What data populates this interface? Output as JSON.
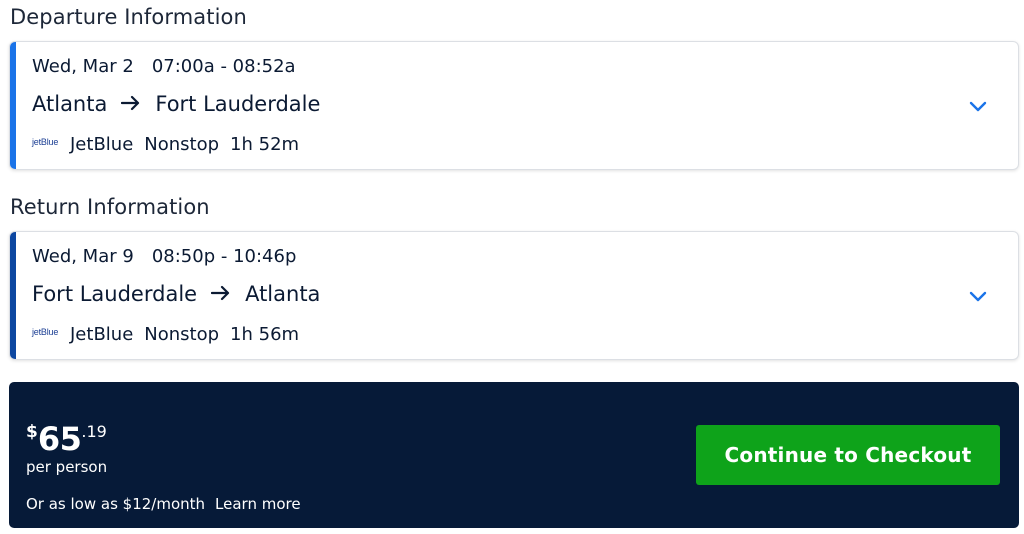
{
  "departure": {
    "heading": "Departure Information",
    "accent_color": "#1a73e8",
    "date": "Wed, Mar 2",
    "time": "07:00a - 08:52a",
    "origin": "Atlanta",
    "destination": "Fort Lauderdale",
    "airline_logo": "jetBlue",
    "airline": "JetBlue",
    "stops": "Nonstop",
    "duration": "1h 52m"
  },
  "return": {
    "heading": "Return Information",
    "accent_color": "#0d47a1",
    "date": "Wed, Mar 9",
    "time": "08:50p - 10:46p",
    "origin": "Fort Lauderdale",
    "destination": "Atlanta",
    "airline_logo": "jetBlue",
    "airline": "JetBlue",
    "stops": "Nonstop",
    "duration": "1h 56m"
  },
  "price": {
    "currency": "$",
    "whole": "65",
    "cents": ".19",
    "per_person": "per person",
    "financing": "Or as low as $12/month",
    "learn_more": "Learn more",
    "background_color": "#061a38"
  },
  "checkout": {
    "label": "Continue to Checkout",
    "color": "#0ea31a"
  },
  "icons": {
    "arrow": "arrow-right-icon",
    "expand": "chevron-down-icon"
  }
}
